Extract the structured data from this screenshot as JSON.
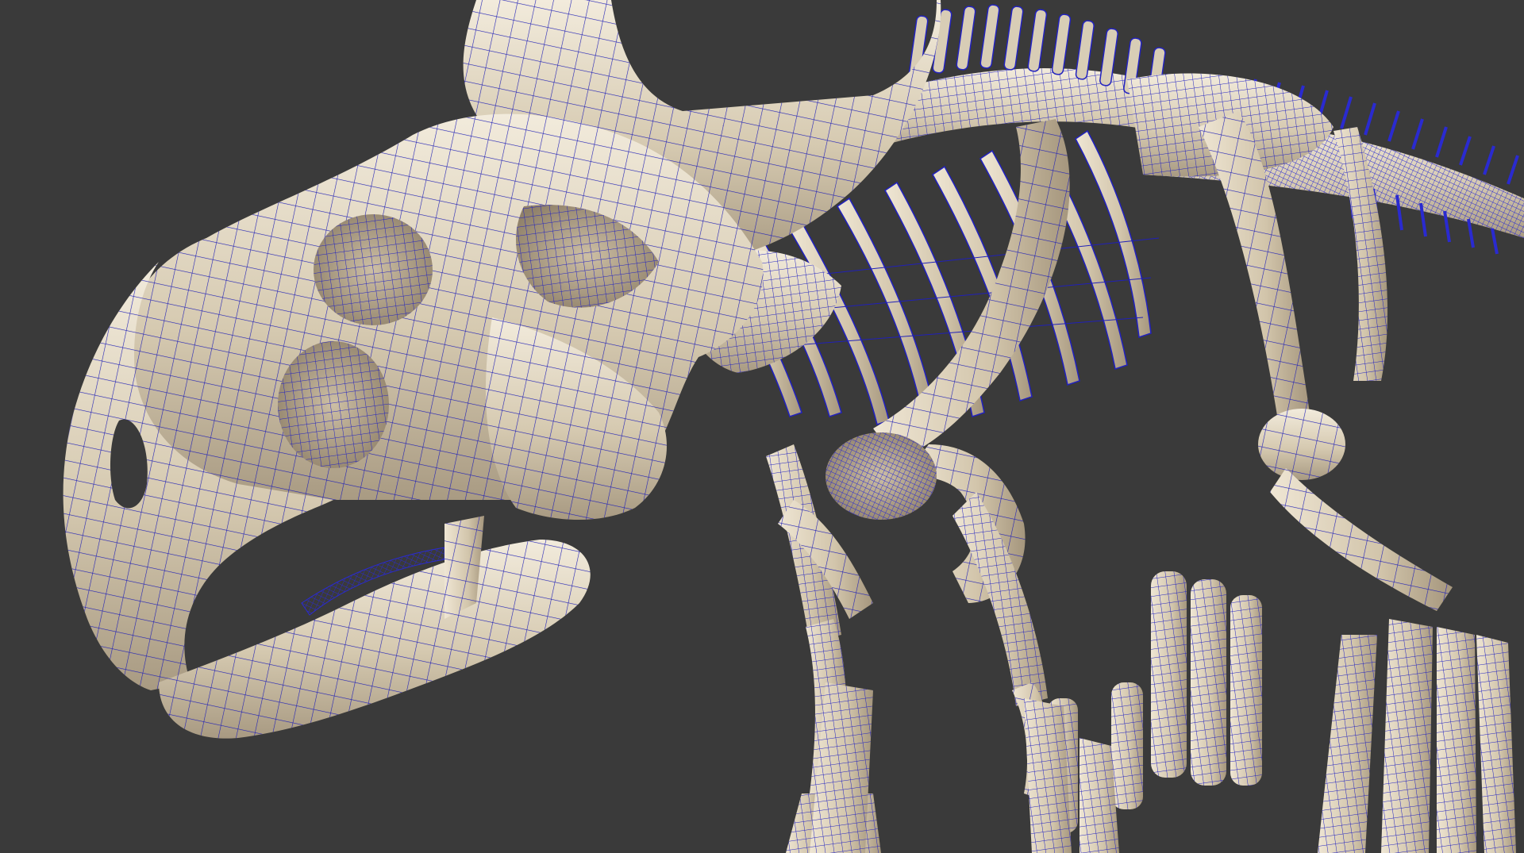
{
  "viewport": {
    "background_color": "#3a3a3a",
    "bone_color": "#d8cdb6",
    "bone_highlight_color": "#f0e8d8",
    "bone_shadow_color": "#9a8d78",
    "bone_tint_color": "#e8b8a4",
    "wire_color": "#2020b8",
    "shading_mode": "smooth-shade-with-wireframe"
  }
}
